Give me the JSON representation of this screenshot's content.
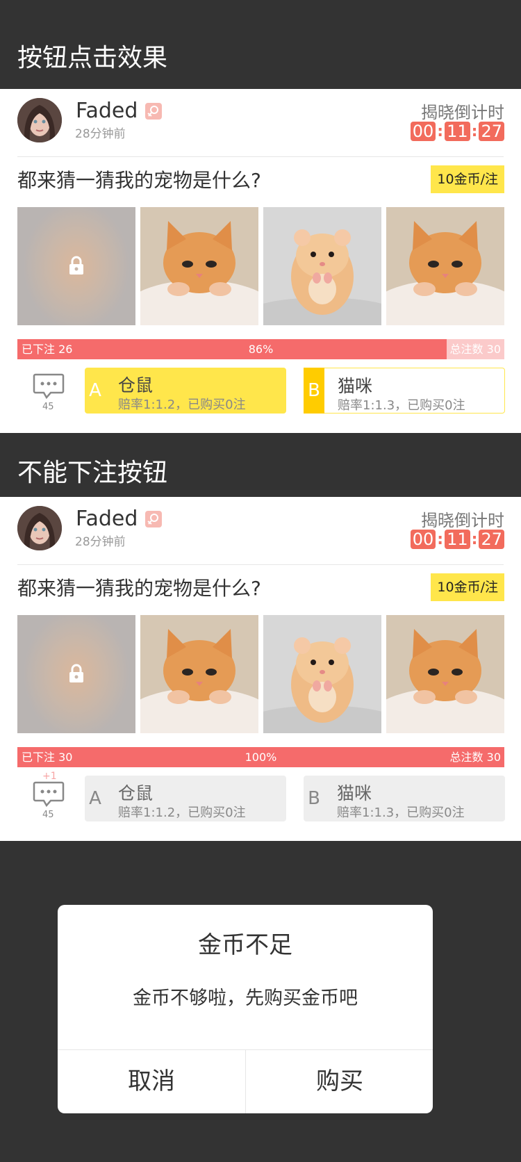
{
  "sections": [
    {
      "title": "按钮点击效果",
      "post": {
        "username": "Faded",
        "time_ago": "28分钟前",
        "countdown_label": "揭晓倒计时",
        "countdown": {
          "hh": "00",
          "mm": "11",
          "ss": "27"
        },
        "question": "都来猜一猜我的宠物是什么?",
        "price": "10金币/注",
        "progress": {
          "placed": "已下注 26",
          "percent": "86%",
          "total": "总注数 30",
          "fill": 0.86
        },
        "comments": "45",
        "comment_delta": "",
        "options": [
          {
            "letter": "A",
            "name": "仓鼠",
            "odds": "赔率1:1.2，已购买0注"
          },
          {
            "letter": "B",
            "name": "猫咪",
            "odds": "赔率1:1.3，已购买0注"
          }
        ]
      }
    },
    {
      "title": "不能下注按钮",
      "post": {
        "username": "Faded",
        "time_ago": "28分钟前",
        "countdown_label": "揭晓倒计时",
        "countdown": {
          "hh": "00",
          "mm": "11",
          "ss": "27"
        },
        "question": "都来猜一猜我的宠物是什么?",
        "price": "10金币/注",
        "progress": {
          "placed": "已下注 30",
          "percent": "100%",
          "total": "总注数 30",
          "fill": 1.0
        },
        "comments": "45",
        "comment_delta": "+1",
        "options": [
          {
            "letter": "A",
            "name": "仓鼠",
            "odds": "赔率1:1.2，已购买0注"
          },
          {
            "letter": "B",
            "name": "猫咪",
            "odds": "赔率1:1.3，已购买0注"
          }
        ]
      }
    }
  ],
  "dialog": {
    "title": "金币不足",
    "message": "金币不够啦，先购买金币吧",
    "cancel": "取消",
    "confirm": "购买"
  },
  "icons": {
    "gender": "female-icon",
    "lock": "lock-icon",
    "comment": "comment-icon"
  },
  "colors": {
    "countdown": "#f26b5c",
    "progress": "#f56b6b",
    "accent_yellow": "#ffe64b",
    "option_b_letter_bg": "#ffcc00",
    "disabled_option": "#eeeeee"
  }
}
